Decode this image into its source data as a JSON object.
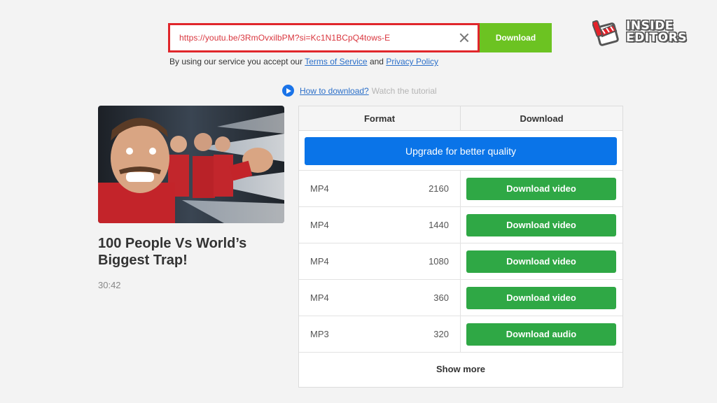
{
  "search": {
    "url": "https://youtu.be/3RmOvxilbPM?si=Kc1N1BCpQ4tows-E",
    "button_label": "Download"
  },
  "terms": {
    "prefix": "By using our service you accept our",
    "tos": "Terms of Service",
    "and": "and",
    "privacy": "Privacy Policy"
  },
  "howto": {
    "link": "How to download?",
    "note": "Watch the tutorial"
  },
  "logo": {
    "line1": "INSIDE",
    "line2": "EDITORS"
  },
  "video": {
    "title": "100 People Vs World’s Biggest Trap!",
    "duration": "30:42"
  },
  "table": {
    "header_format": "Format",
    "header_download": "Download",
    "upgrade_label": "Upgrade for better quality",
    "rows": [
      {
        "format": "MP4",
        "quality": "2160",
        "button": "Download video"
      },
      {
        "format": "MP4",
        "quality": "1440",
        "button": "Download video"
      },
      {
        "format": "MP4",
        "quality": "1080",
        "button": "Download video"
      },
      {
        "format": "MP4",
        "quality": "360",
        "button": "Download video"
      },
      {
        "format": "MP3",
        "quality": "320",
        "button": "Download audio"
      }
    ],
    "show_more": "Show more"
  },
  "colors": {
    "accent_green": "#6cc322",
    "download_green": "#2fa845",
    "upgrade_blue": "#0a74e8",
    "url_red": "#e0262b"
  }
}
